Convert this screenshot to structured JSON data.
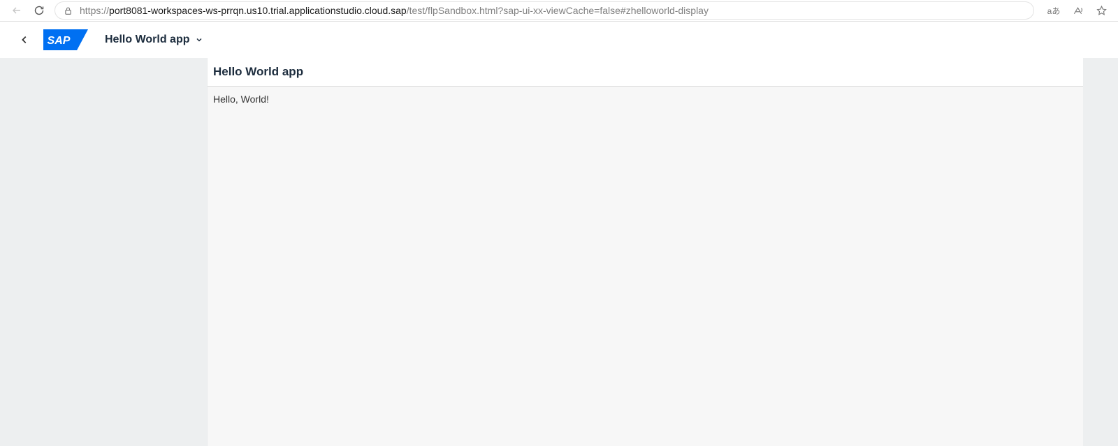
{
  "browser": {
    "url_protocol": "https://",
    "url_host": "port8081-workspaces-ws-prrqn.us10.trial.applicationstudio.cloud.sap",
    "url_path": "/test/flpSandbox.html?sap-ui-xx-viewCache=false#zhelloworld-display",
    "translate_icon": "aあ",
    "read_aloud_icon": "Aᵀ"
  },
  "shell": {
    "logo_text": "SAP",
    "title": "Hello World app"
  },
  "page": {
    "header_title": "Hello World app",
    "body_text": "Hello, World!"
  }
}
